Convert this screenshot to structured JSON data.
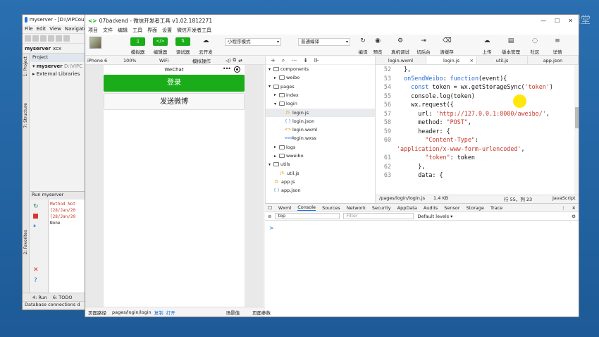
{
  "watermark": {
    "text": "网易云课堂"
  },
  "ide": {
    "title": "myserver - [D:\\VIPCours",
    "menu": [
      "File",
      "Edit",
      "View",
      "Navigate"
    ],
    "tabs": [
      "myserver",
      "xcx"
    ],
    "sidebar_labels": [
      "1: Project",
      "7: Structure",
      "2: Favorites"
    ],
    "project_header": "Project",
    "project_rows": [
      "myserver",
      "External Libraries"
    ],
    "project_path": "D:\\VIPC",
    "run_header": "Run  myserver",
    "run_output": [
      "Method Not",
      "[28/Jan/20",
      "[28/Jan/20"
    ],
    "run_output_plain": "None",
    "bottom_tabs": [
      "4: Run",
      "6: TODO"
    ],
    "status": "Database connections d"
  },
  "wx": {
    "title": "07backend - 微信开发者工具 v1.02.1812271",
    "title_symbol": "<>",
    "menu": [
      "项目",
      "文件",
      "编辑",
      "工具",
      "界面",
      "设置",
      "微信开发者工具"
    ],
    "toolbar": {
      "green_buttons": [
        "模拟器",
        "编辑器",
        "调试器"
      ],
      "green_button_glyphs": [
        "▯",
        "</>",
        "⇅"
      ],
      "cloud": "云开发",
      "mode_select": "小程序模式",
      "compile_select": "普通编译",
      "actions": [
        "编译",
        "预览",
        "真机调试",
        "切后台",
        "清缓存"
      ],
      "right_actions": [
        "上传",
        "版本管理",
        "社区",
        "详情"
      ]
    },
    "simulator": {
      "device": "iPhone 6",
      "zoom": "100%",
      "network": "WiFi",
      "sim_ops": "模拟操作",
      "header_title": "WeChat",
      "header_dots": "•••",
      "login_button": "登录",
      "weibo_button": "发送微博"
    },
    "files": [
      {
        "name": "components",
        "type": "folder",
        "open": true,
        "depth": 1
      },
      {
        "name": "weibo",
        "type": "folder",
        "open": false,
        "depth": 2
      },
      {
        "name": "pages",
        "type": "folder",
        "open": true,
        "depth": 1
      },
      {
        "name": "index",
        "type": "folder",
        "open": false,
        "depth": 2
      },
      {
        "name": "login",
        "type": "folder",
        "open": true,
        "depth": 2
      },
      {
        "name": "login.js",
        "type": "js",
        "depth": 3,
        "selected": true
      },
      {
        "name": "login.json",
        "type": "json",
        "depth": 3
      },
      {
        "name": "login.wxml",
        "type": "wxml",
        "depth": 3
      },
      {
        "name": "login.wxss",
        "type": "wxss",
        "depth": 3
      },
      {
        "name": "logs",
        "type": "folder",
        "open": false,
        "depth": 2
      },
      {
        "name": "wweibo",
        "type": "folder",
        "open": false,
        "depth": 2
      },
      {
        "name": "utils",
        "type": "folder",
        "open": true,
        "depth": 1
      },
      {
        "name": "util.js",
        "type": "js",
        "depth": 2
      },
      {
        "name": "app.js",
        "type": "js",
        "depth": 1
      },
      {
        "name": "app.json",
        "type": "json",
        "depth": 1
      }
    ],
    "editor": {
      "tabs": [
        "login.wxml",
        "login.js",
        "util.js",
        "app.json"
      ],
      "active_tab": 1,
      "lines": [
        {
          "n": "52",
          "parts": [
            [
              "ctext",
              "  },"
            ]
          ]
        },
        {
          "n": "53",
          "parts": [
            [
              "ctext",
              "  "
            ],
            [
              "kw",
              "onSendWeibo"
            ],
            [
              "ctext",
              ": "
            ],
            [
              "kw",
              "function"
            ],
            [
              "ctext",
              "(event){"
            ]
          ]
        },
        {
          "n": "54",
          "parts": [
            [
              "ctext",
              "    "
            ],
            [
              "kw",
              "const"
            ],
            [
              "ctext",
              " token = wx.getStorageSync("
            ],
            [
              "str",
              "'token'"
            ],
            [
              "ctext",
              ")"
            ]
          ]
        },
        {
          "n": "55",
          "parts": [
            [
              "ctext",
              "    console.log(token)"
            ]
          ]
        },
        {
          "n": "56",
          "parts": [
            [
              "ctext",
              "    wx.request({"
            ]
          ]
        },
        {
          "n": "57",
          "parts": [
            [
              "ctext",
              "      url: "
            ],
            [
              "str",
              "'http://127.0.0.1:8000/aweibo/'"
            ],
            [
              "ctext",
              ","
            ]
          ]
        },
        {
          "n": "58",
          "parts": [
            [
              "ctext",
              "      method: "
            ],
            [
              "str",
              "\"POST\""
            ],
            [
              "ctext",
              ","
            ]
          ]
        },
        {
          "n": "59",
          "parts": [
            [
              "ctext",
              "      header: {"
            ]
          ]
        },
        {
          "n": "60",
          "parts": [
            [
              "ctext",
              "        "
            ],
            [
              "str",
              "\"Content-Type\""
            ],
            [
              "ctext",
              ":"
            ]
          ]
        },
        {
          "n": "",
          "parts": [
            [
              "str",
              "'application/x-www-form-urlencoded'"
            ],
            [
              "ctext",
              ","
            ]
          ]
        },
        {
          "n": "61",
          "parts": [
            [
              "ctext",
              "        "
            ],
            [
              "str",
              "\"token\""
            ],
            [
              "ctext",
              ": token"
            ]
          ]
        },
        {
          "n": "62",
          "parts": [
            [
              "ctext",
              "      },"
            ]
          ]
        },
        {
          "n": "63",
          "parts": [
            [
              "ctext",
              "      data: {"
            ]
          ]
        }
      ],
      "status_path": "/pages/login/login.js",
      "status_size": "1.4 KB",
      "status_pos": "行 55，列 23",
      "status_lang": "JavaScript"
    },
    "console": {
      "tabs": [
        "Wxml",
        "Console",
        "Sources",
        "Network",
        "Security",
        "AppData",
        "Audits",
        "Sensor",
        "Storage",
        "Trace"
      ],
      "active": "Console",
      "context": "top",
      "filter_placeholder": "Filter",
      "levels": "Default levels ▾",
      "prompt": ">"
    },
    "status_bar": {
      "path_label": "页面路径",
      "path": "pages/login/login",
      "copy": "复制",
      "open": "打开",
      "scene": "场景值",
      "params": "页面参数"
    }
  }
}
